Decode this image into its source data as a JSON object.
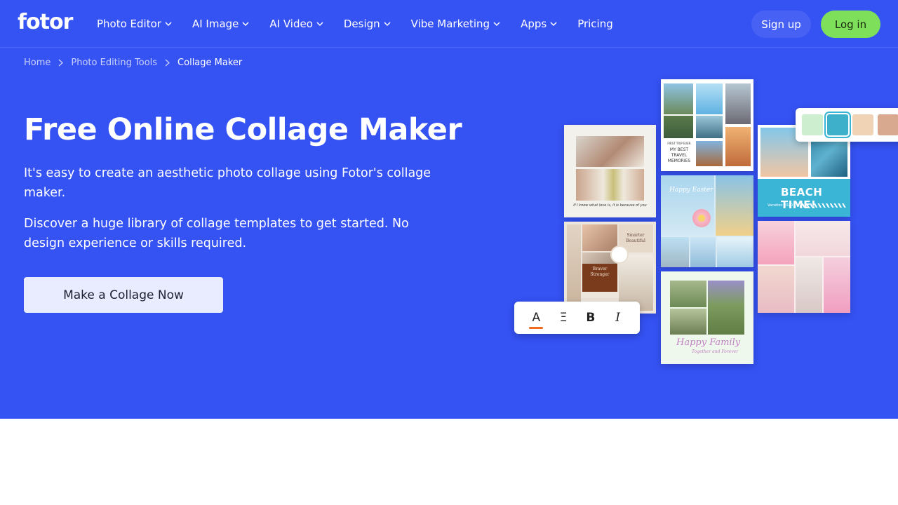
{
  "header": {
    "logo": "fotor",
    "nav": [
      {
        "label": "Photo Editor",
        "dropdown": true
      },
      {
        "label": "AI Image",
        "dropdown": true
      },
      {
        "label": "AI Video",
        "dropdown": true
      },
      {
        "label": "Design",
        "dropdown": true
      },
      {
        "label": "Vibe Marketing",
        "dropdown": true
      },
      {
        "label": "Apps",
        "dropdown": true
      },
      {
        "label": "Pricing",
        "dropdown": false
      }
    ],
    "signup_label": "Sign up",
    "login_label": "Log in"
  },
  "breadcrumb": {
    "items": [
      "Home",
      "Photo Editing Tools",
      "Collage Maker"
    ]
  },
  "hero": {
    "title": "Free Online Collage Maker",
    "paragraph1": "It's easy to create an aesthetic photo collage using Fotor's collage maker.",
    "paragraph2": "Discover a huge library of collage templates to get started. No design experience or skills required.",
    "cta_label": "Make a Collage Now"
  },
  "collage": {
    "travel_card": {
      "small": "FIRST TRIP EVER",
      "text": "MY BEST TRAVEL MEMORIES"
    },
    "quote_card": {
      "quote": "If I know what love is, it is because of you"
    },
    "easter_card": {
      "title": "Happy Easter"
    },
    "beach_card": {
      "title": "BEACH TIME!",
      "subtitle": "Vacation 2020"
    },
    "brave_card": {
      "top": "Smarter Beautiful",
      "bottom": "Braver Stronger"
    },
    "family_card": {
      "title": "Happy Family",
      "subtitle": "Together and Forever"
    }
  },
  "text_toolbar": {
    "tools": [
      {
        "glyph": "A",
        "icon": "text-color-icon"
      },
      {
        "glyph": "Ξ",
        "icon": "align-icon"
      },
      {
        "glyph": "B",
        "icon": "bold-icon"
      },
      {
        "glyph": "I",
        "icon": "italic-icon"
      }
    ]
  },
  "swatch_colors": [
    "#cdeecf",
    "#3fb0c9",
    "#f0d2b4",
    "#d8a98e"
  ],
  "colors": {
    "hero_bg": "#3552f3",
    "login_bg": "#7ee05a",
    "cta_bg": "#e8ecfe"
  }
}
